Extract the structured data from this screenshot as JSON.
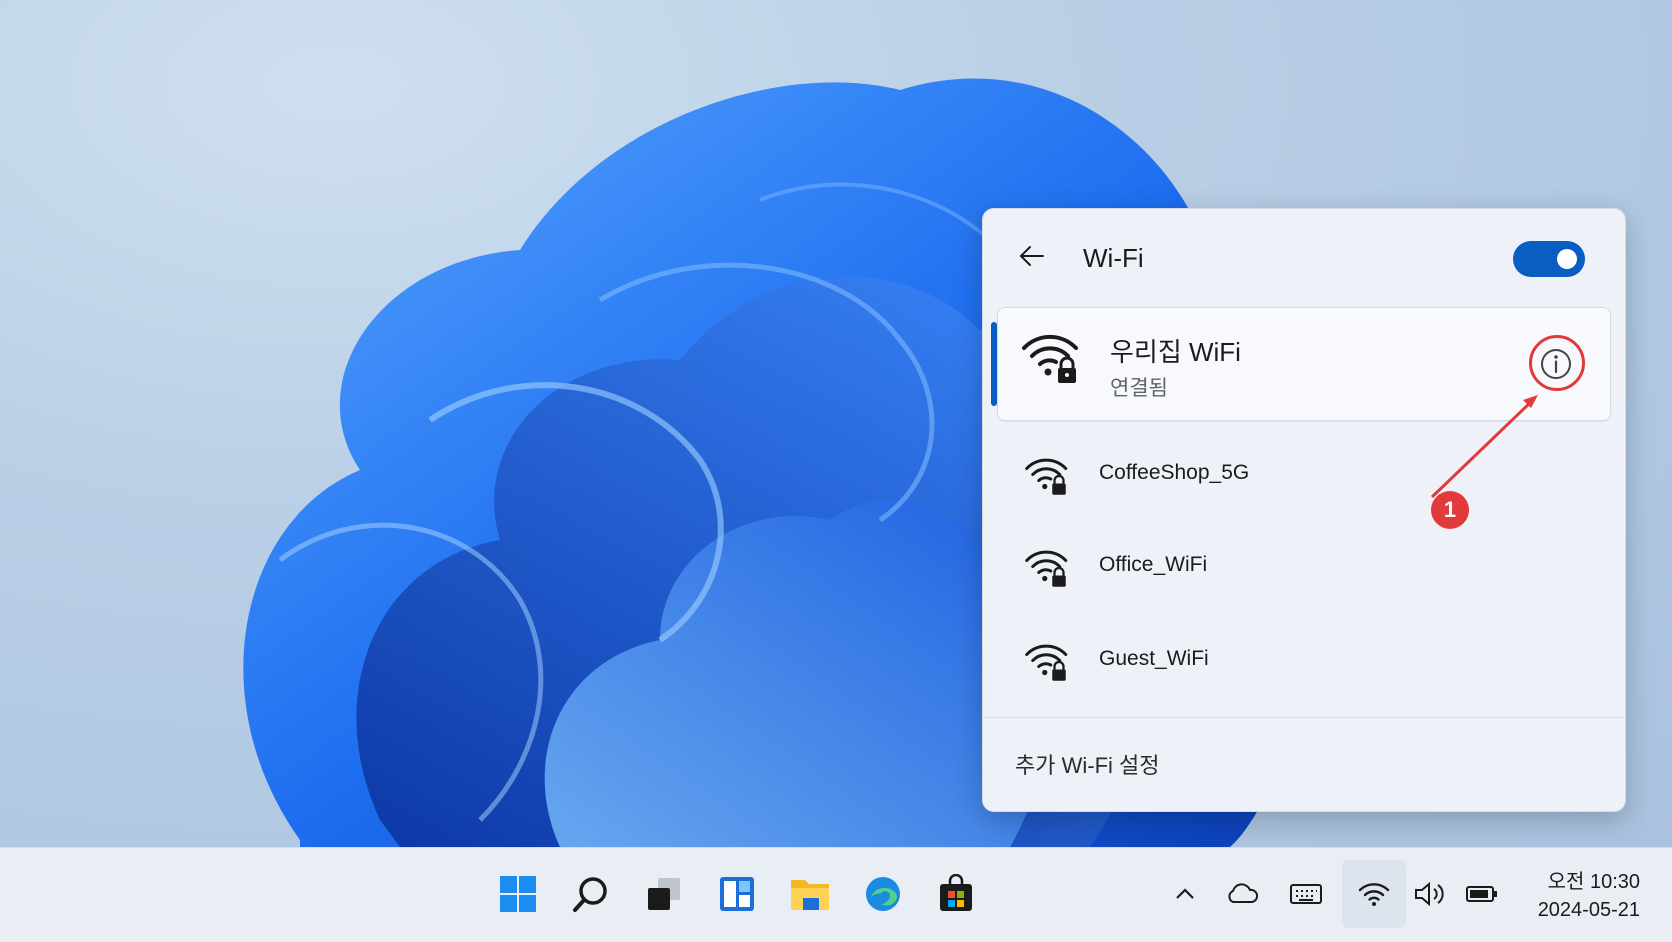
{
  "flyout": {
    "title": "Wi-Fi",
    "toggle_on": true,
    "connected_network": {
      "name": "우리집 WiFi",
      "status": "연결됨"
    },
    "networks": [
      {
        "name": "CoffeeShop_5G"
      },
      {
        "name": "Office_WiFi"
      },
      {
        "name": "Guest_WiFi"
      }
    ],
    "more_settings": "추가 Wi-Fi 설정"
  },
  "annotation": {
    "badge": "1"
  },
  "taskbar": {
    "pinned": [
      "windows-start-icon",
      "search-icon",
      "task-view-icon",
      "widgets-icon",
      "file-explorer-icon",
      "edge-icon",
      "store-icon"
    ],
    "tray": [
      "chevron-up-icon",
      "onedrive-icon",
      "keyboard-icon",
      "wifi-icon",
      "volume-icon",
      "battery-icon"
    ],
    "clock": {
      "time": "오전 10:30",
      "date": "2024-05-21"
    }
  },
  "colors": {
    "accent": "#0a5dc2",
    "annotation": "#e23a3a",
    "flyout_bg": "#eef2f8"
  }
}
